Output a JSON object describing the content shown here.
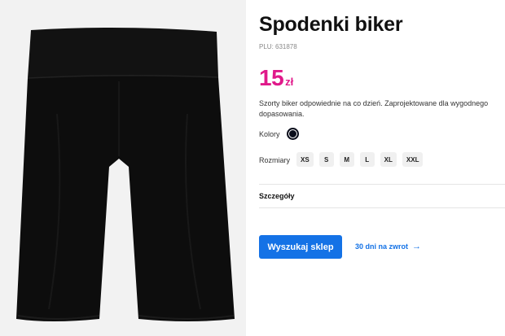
{
  "product": {
    "title": "Spodenki biker",
    "plu": "PLU: 631878",
    "price_amount": "15",
    "price_currency": "zł",
    "description": "Szorty biker odpowiednie na co dzień. Zaprojektowane dla wygodnego dopasowania.",
    "image_alt": "black biker shorts"
  },
  "colors": {
    "label": "Kolory",
    "selected_swatch": "#0b0e1c"
  },
  "sizes": {
    "label": "Rozmiary",
    "options": [
      "XS",
      "S",
      "M",
      "L",
      "XL",
      "XXL"
    ]
  },
  "details": {
    "label": "Szczegóły"
  },
  "actions": {
    "store_button": "Wyszukaj sklep",
    "return_link": "30 dni na zwrot",
    "return_arrow_icon": "arrow-right-icon"
  },
  "theme": {
    "price_color": "#e0198a",
    "accent_blue": "#1472e6",
    "image_background": "#f2f2f2"
  }
}
